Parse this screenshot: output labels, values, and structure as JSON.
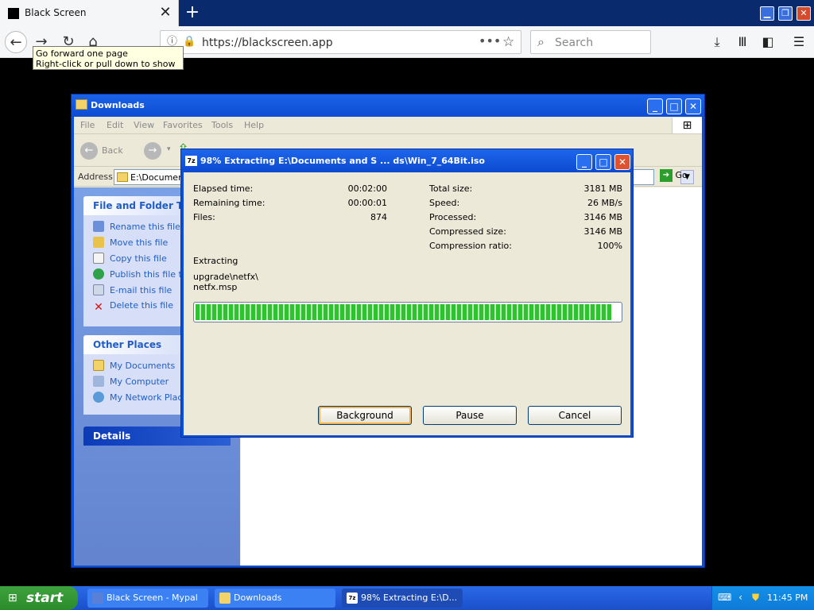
{
  "browser": {
    "tab_title": "Black Screen",
    "url": "https://blackscreen.app",
    "search_placeholder": "Search",
    "tooltip_line1": "Go forward one page",
    "tooltip_line2": "Right-click or pull down to show history"
  },
  "explorer": {
    "title": "Downloads",
    "menu": [
      "File",
      "Edit",
      "View",
      "Favorites",
      "Tools",
      "Help"
    ],
    "back_label": "Back",
    "address_label": "Address",
    "address_value": "E:\\Document",
    "go_label": "Go",
    "file_tasks_header": "File and Folder Tasks",
    "file_tasks": [
      "Rename this file",
      "Move this file",
      "Copy this file",
      "Publish this file to",
      "E-mail this file",
      "Delete this file"
    ],
    "other_places_header": "Other Places",
    "other_places": [
      "My Documents",
      "My Computer",
      "My Network Place"
    ],
    "details_header": "Details"
  },
  "dialog": {
    "title": "98% Extracting E:\\Documents and S ... ds\\Win_7_64Bit.iso",
    "stats_left": [
      {
        "label": "Elapsed time:",
        "value": "00:02:00"
      },
      {
        "label": "Remaining time:",
        "value": "00:00:01"
      },
      {
        "label": "Files:",
        "value": "874"
      }
    ],
    "stats_right": [
      {
        "label": "Total size:",
        "value": "3181 MB"
      },
      {
        "label": "Speed:",
        "value": "26 MB/s"
      },
      {
        "label": "Processed:",
        "value": "3146 MB"
      },
      {
        "label": "Compressed size:",
        "value": "3146 MB"
      },
      {
        "label": "Compression ratio:",
        "value": "100%"
      }
    ],
    "status": "Extracting",
    "path_line1": "upgrade\\netfx\\",
    "path_line2": "netfx.msp",
    "progress_percent": 98,
    "buttons": {
      "background": "Background",
      "pause": "Pause",
      "cancel": "Cancel"
    }
  },
  "taskbar": {
    "start_label": "start",
    "tasks": [
      "Black Screen - Mypal",
      "Downloads",
      "98% Extracting E:\\D..."
    ],
    "clock": "11:45 PM"
  }
}
